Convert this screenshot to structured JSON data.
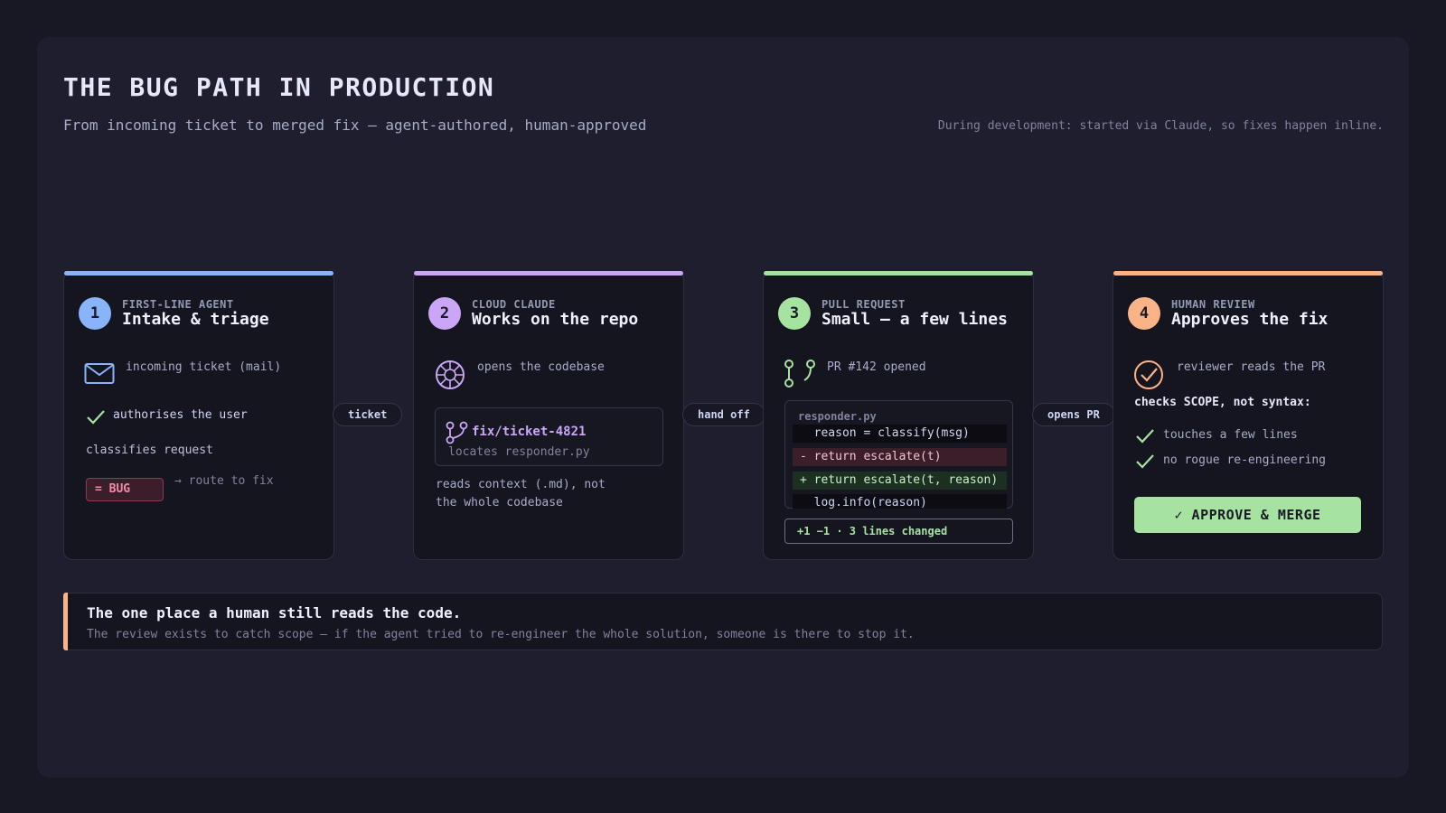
{
  "header": {
    "title": "THE BUG PATH IN PRODUCTION",
    "subtitle": "From incoming ticket to merged fix — agent-authored, human-approved",
    "note": "During development: started via Claude, so fixes happen inline."
  },
  "colors": {
    "step1": "#89b4fa",
    "step2": "#cba6f7",
    "step3": "#a6e3a1",
    "step4": "#fab387",
    "bug": "#f38ba8"
  },
  "connectors": [
    "ticket",
    "hand off",
    "opens PR"
  ],
  "step1": {
    "number": "1",
    "kicker": "FIRST-LINE AGENT",
    "heading": "Intake & triage",
    "mail_text": "incoming ticket (mail)",
    "auth_text": "authorises the user",
    "classify_text": "classifies request",
    "badge": "= BUG",
    "route_text": "→ route to fix"
  },
  "step2": {
    "number": "2",
    "kicker": "CLOUD CLAUDE",
    "heading": "Works on the repo",
    "codebase_text": "opens the codebase",
    "branch": "fix/ticket-4821",
    "locates": "locates responder.py",
    "context_line1": "reads context (.md), not",
    "context_line2": "the whole codebase"
  },
  "step3": {
    "number": "3",
    "kicker": "PULL REQUEST",
    "heading": "Small — a few lines",
    "pr_text": "PR #142 opened",
    "filename": "responder.py",
    "lines": [
      {
        "kind": "ctx",
        "text": "  reason = classify(msg)"
      },
      {
        "kind": "del",
        "text": "- return escalate(t)"
      },
      {
        "kind": "add",
        "text": "+ return escalate(t, reason)"
      },
      {
        "kind": "ctx",
        "text": "  log.info(reason)"
      }
    ],
    "summary": "+1 −1 · 3 lines changed"
  },
  "step4": {
    "number": "4",
    "kicker": "HUMAN REVIEW",
    "heading": "Approves the fix",
    "reads_text": "reviewer reads the PR",
    "checks_title": "checks SCOPE, not syntax:",
    "check1": "touches a few lines",
    "check2": "no rogue re-engineering",
    "approve_label": "✓ APPROVE & MERGE"
  },
  "callout": {
    "title": "The one place a human still reads the code.",
    "body": "The review exists to catch scope — if the agent tried to re-engineer the whole solution, someone is there to stop it."
  }
}
